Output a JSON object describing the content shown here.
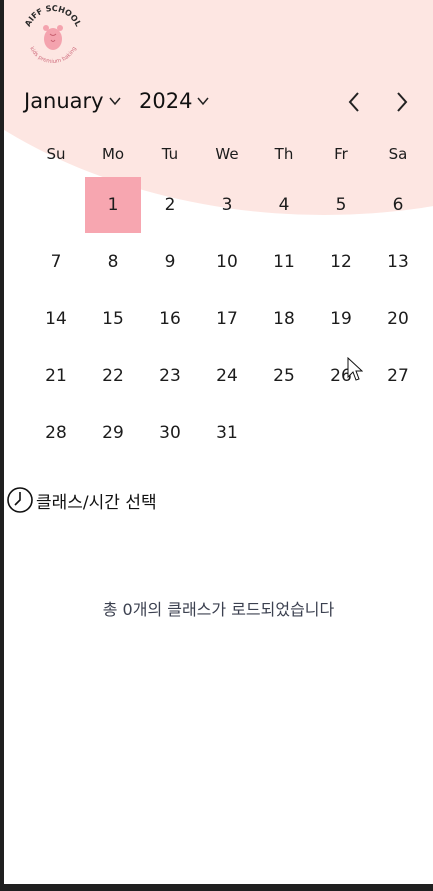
{
  "logo": {
    "title": "AIFF SCHOOL",
    "tagline": "kids premium baking",
    "icon": "bear-icon"
  },
  "calendar": {
    "month": "January",
    "year": "2024",
    "prev_icon": "chevron-left-icon",
    "next_icon": "chevron-right-icon",
    "weekdays": [
      "Su",
      "Mo",
      "Tu",
      "We",
      "Th",
      "Fr",
      "Sa"
    ],
    "days": [
      "1",
      "2",
      "3",
      "4",
      "5",
      "6",
      "7",
      "8",
      "9",
      "10",
      "11",
      "12",
      "13",
      "14",
      "15",
      "16",
      "17",
      "18",
      "19",
      "20",
      "21",
      "22",
      "23",
      "24",
      "25",
      "26",
      "27",
      "28",
      "29",
      "30",
      "31"
    ],
    "first_weekday_index": 1,
    "selected_day": "1",
    "selected_color": "#f7a6b0",
    "header_bg_color": "#fde6e2"
  },
  "class_section": {
    "title": "클래스/시간 선택",
    "icon": "clock-icon"
  },
  "status": {
    "message": "총 0개의 클래스가 로드되었습니다"
  }
}
